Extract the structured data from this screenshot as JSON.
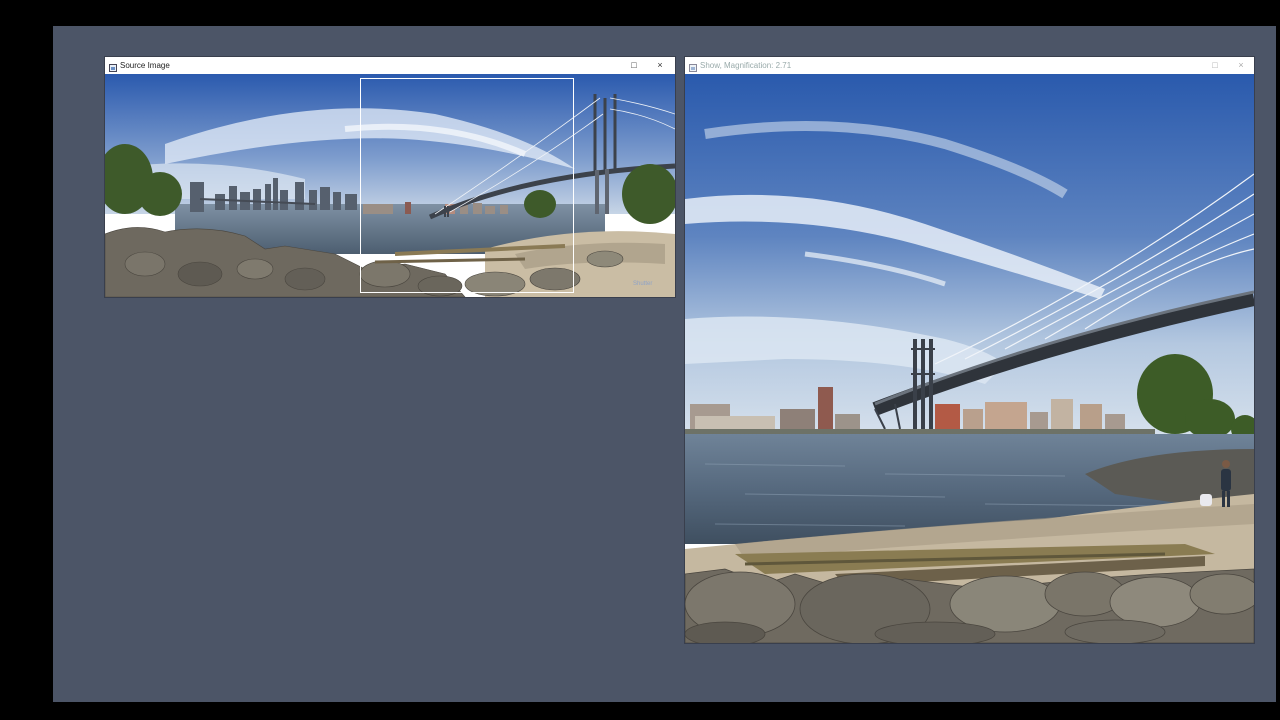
{
  "source_window": {
    "title": "Source Image",
    "icon": "image-window-icon",
    "maximize_icon": "□",
    "close_icon": "×",
    "watermark": "Shutter"
  },
  "magnified_window": {
    "title": "Show, Magnification: 2.71",
    "icon": "image-window-icon",
    "maximize_icon": "□",
    "close_icon": "×"
  },
  "colors": {
    "desktop": "#4c5567",
    "sky_top": "#2e5cb0",
    "sky_low": "#a9c0dc",
    "water": "#5d6f83",
    "rocks": "#6f6a60",
    "beach": "#c9bda6",
    "bridge": "#3a3f47"
  }
}
